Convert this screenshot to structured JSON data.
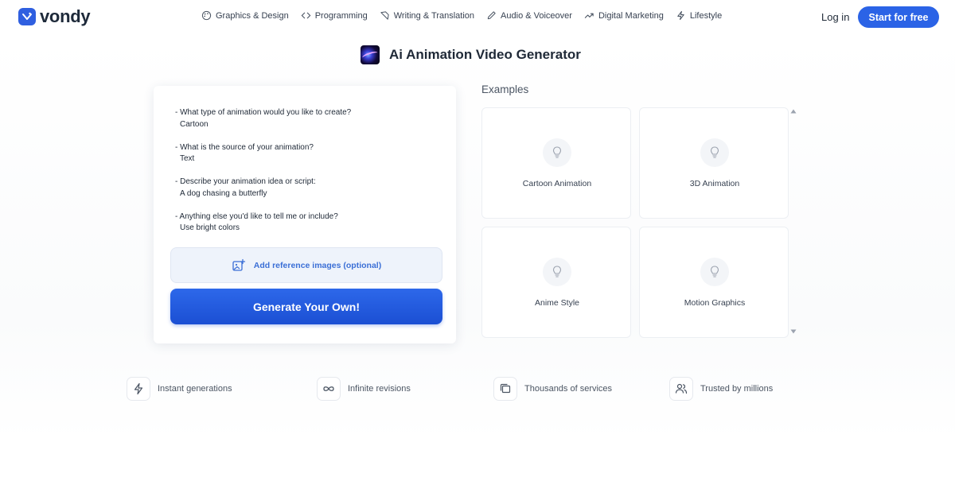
{
  "header": {
    "logo_text": "vondy",
    "nav": [
      {
        "label": "Graphics & Design",
        "icon": "palette-icon"
      },
      {
        "label": "Programming",
        "icon": "code-icon"
      },
      {
        "label": "Writing & Translation",
        "icon": "pen-nib-icon"
      },
      {
        "label": "Audio & Voiceover",
        "icon": "pencil-icon"
      },
      {
        "label": "Digital Marketing",
        "icon": "trend-up-icon"
      },
      {
        "label": "Lifestyle",
        "icon": "lightning-icon"
      }
    ],
    "login_label": "Log in",
    "start_label": "Start for free"
  },
  "page": {
    "title": "Ai Animation Video Generator"
  },
  "form": {
    "prompt": [
      {
        "q": "- What type of animation would you like to create?",
        "a": "Cartoon"
      },
      {
        "q": "- What is the source of your animation?",
        "a": "Text"
      },
      {
        "q": "- Describe your animation idea or script:",
        "a": "A dog chasing a butterfly"
      },
      {
        "q": "- Anything else you'd like to tell me or include?",
        "a": "Use bright colors"
      }
    ],
    "reference_label": "Add reference images (optional)",
    "generate_label": "Generate Your Own!"
  },
  "examples": {
    "label": "Examples",
    "items": [
      {
        "label": "Cartoon Animation"
      },
      {
        "label": "3D Animation"
      },
      {
        "label": "Anime Style"
      },
      {
        "label": "Motion Graphics"
      }
    ]
  },
  "features": [
    {
      "label": "Instant generations",
      "icon": "lightning-icon"
    },
    {
      "label": "Infinite revisions",
      "icon": "infinity-icon"
    },
    {
      "label": "Thousands of services",
      "icon": "stack-icon"
    },
    {
      "label": "Trusted by millions",
      "icon": "users-icon"
    }
  ],
  "colors": {
    "accent": "#2b63e6",
    "generate_button": "#1b4fd3",
    "reference_text": "#3b6fd6"
  }
}
